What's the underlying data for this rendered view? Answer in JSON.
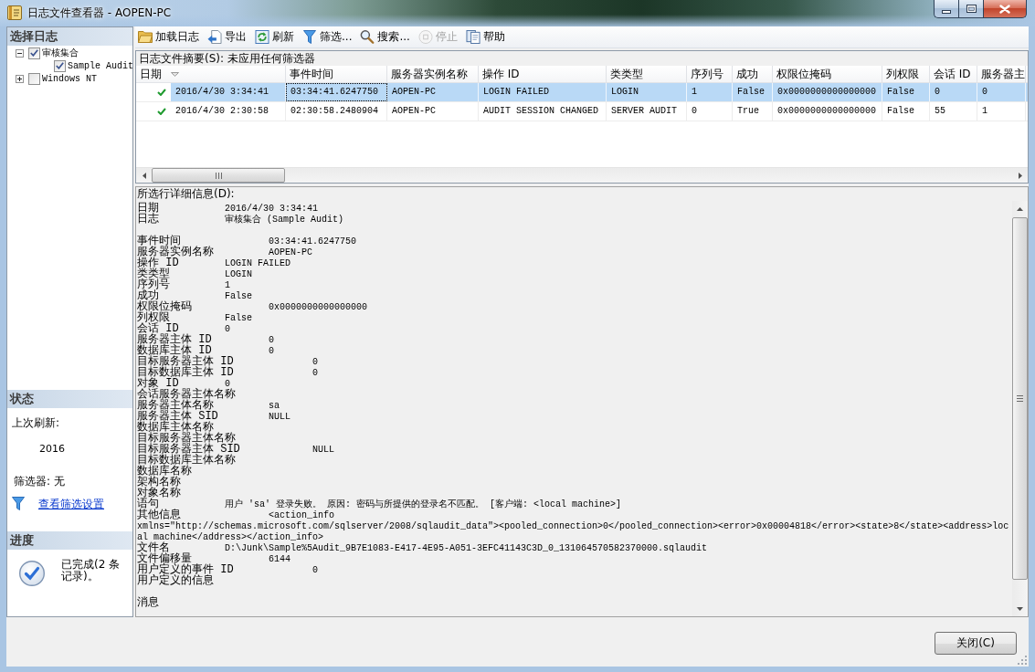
{
  "window": {
    "title": "日志文件查看器 - AOPEN-PC"
  },
  "sidebar": {
    "log_title": "选择日志",
    "log_tree": [
      {
        "label": "审核集合",
        "checked": true,
        "expanded": true,
        "children": [
          {
            "label": "Sample Audit",
            "checked": true
          }
        ]
      },
      {
        "label": "Windows NT",
        "checked": false,
        "expanded": false
      }
    ],
    "status": {
      "title": "状态",
      "last_refresh_label": "上次刷新:",
      "last_refresh_value": "2016",
      "filter_text": "筛选器: 无",
      "filter_link": "查看筛选设置"
    },
    "progress": {
      "title": "进度",
      "message": "已完成(2 条记录)。"
    }
  },
  "toolbar": [
    {
      "label": "加载日志",
      "disabled": false
    },
    {
      "label": "导出",
      "disabled": false
    },
    {
      "label": "刷新",
      "disabled": false
    },
    {
      "label": "筛选...",
      "disabled": false
    },
    {
      "label": "搜索...",
      "disabled": false
    },
    {
      "label": "停止",
      "disabled": true
    },
    {
      "label": "帮助",
      "disabled": false
    }
  ],
  "table": {
    "caption": "日志文件摘要(S): 未应用任何筛选器",
    "columns": [
      {
        "label": "日期",
        "sorted": true
      },
      {
        "label": "事件时间",
        "sorted": false
      },
      {
        "label": "服务器实例名称",
        "sorted": false
      },
      {
        "label": "操作 ID",
        "sorted": false
      },
      {
        "label": "类类型",
        "sorted": false
      },
      {
        "label": "序列号",
        "sorted": false
      },
      {
        "label": "成功",
        "sorted": false
      },
      {
        "label": "权限位掩码",
        "sorted": false
      },
      {
        "label": "列权限",
        "sorted": false
      },
      {
        "label": "会话 ID",
        "sorted": false
      },
      {
        "label": "服务器主",
        "sorted": false
      }
    ],
    "rows": [
      {
        "selected": true,
        "cells": [
          {
            "text": "2016/4/30 3:34:41",
            "focused": false
          },
          {
            "text": "03:34:41.6247750",
            "focused": true
          },
          {
            "text": "AOPEN-PC",
            "focused": false
          },
          {
            "text": "LOGIN FAILED",
            "focused": false
          },
          {
            "text": "LOGIN",
            "focused": false
          },
          {
            "text": "1",
            "focused": false
          },
          {
            "text": "False",
            "focused": false
          },
          {
            "text": "0x0000000000000000",
            "focused": false
          },
          {
            "text": "False",
            "focused": false
          },
          {
            "text": "0",
            "focused": false
          },
          {
            "text": "0",
            "focused": false
          }
        ]
      },
      {
        "selected": false,
        "cells": [
          {
            "text": "2016/4/30 2:30:58",
            "focused": false
          },
          {
            "text": "02:30:58.2480904",
            "focused": false
          },
          {
            "text": "AOPEN-PC",
            "focused": false
          },
          {
            "text": "AUDIT SESSION CHANGED",
            "focused": false
          },
          {
            "text": "SERVER AUDIT",
            "focused": false
          },
          {
            "text": "0",
            "focused": false
          },
          {
            "text": "True",
            "focused": false
          },
          {
            "text": "0x0000000000000000",
            "focused": false
          },
          {
            "text": "False",
            "focused": false
          },
          {
            "text": "55",
            "focused": false
          },
          {
            "text": "1",
            "focused": false
          }
        ]
      }
    ]
  },
  "detail": {
    "label": "所选行详细信息(D):",
    "sections": [
      [
        {
          "label": "日期",
          "value": "2016/4/30 3:34:41"
        },
        {
          "label": "日志",
          "value": "审核集合 (Sample Audit)"
        }
      ],
      [
        {
          "label": "事件时间",
          "value": "03:34:41.6247750"
        },
        {
          "label": "服务器实例名称",
          "value": "AOPEN-PC"
        },
        {
          "label": "操作 ID",
          "value": "LOGIN FAILED"
        },
        {
          "label": "类类型",
          "value": "LOGIN"
        },
        {
          "label": "序列号",
          "value": "1"
        },
        {
          "label": "成功",
          "value": "False"
        },
        {
          "label": "权限位掩码",
          "value": "0x0000000000000000"
        },
        {
          "label": "列权限",
          "value": "False"
        },
        {
          "label": "会话 ID",
          "value": "0"
        },
        {
          "label": "服务器主体 ID",
          "value": "0"
        },
        {
          "label": "数据库主体 ID",
          "value": "0"
        },
        {
          "label": "目标服务器主体 ID",
          "value": "0"
        },
        {
          "label": "目标数据库主体 ID",
          "value": "0"
        },
        {
          "label": "对象 ID",
          "value": "0"
        },
        {
          "label": "会话服务器主体名称"
        },
        {
          "label": "服务器主体名称",
          "value": "sa"
        },
        {
          "label": "服务器主体 SID",
          "value": "NULL"
        },
        {
          "label": "数据库主体名称"
        },
        {
          "label": "目标服务器主体名称"
        },
        {
          "label": "目标服务器主体 SID",
          "value": "NULL"
        },
        {
          "label": "目标数据库主体名称"
        },
        {
          "label": "数据库名称"
        },
        {
          "label": "架构名称"
        },
        {
          "label": "对象名称"
        },
        {
          "label": "语句",
          "value": "用户 'sa' 登录失败。 原因: 密码与所提供的登录名不匹配。 [客户端: <local machine>]"
        },
        {
          "label": "其他信息",
          "value": "<action_info",
          "wrapped": [
            "xmlns=\"http://schemas.microsoft.com/sqlserver/2008/sqlaudit_data\"><pooled_connection>0</pooled_connection><error>0x00004818</error><state>8</state><address>loc",
            "al machine</address></action_info>"
          ]
        },
        {
          "label": "文件名",
          "value": "D:\\Junk\\Sample%5Audit_9B7E1083-E417-4E95-A051-3EFC41143C3D_0_131064570582370000.sqlaudit"
        },
        {
          "label": "文件偏移量",
          "value": "6144"
        },
        {
          "label": "用户定义的事件 ID",
          "value": "0"
        },
        {
          "label": "用户定义的信息"
        }
      ],
      [
        {
          "label": "消息"
        }
      ]
    ]
  },
  "footer": {
    "close_button": "关闭(C)"
  }
}
